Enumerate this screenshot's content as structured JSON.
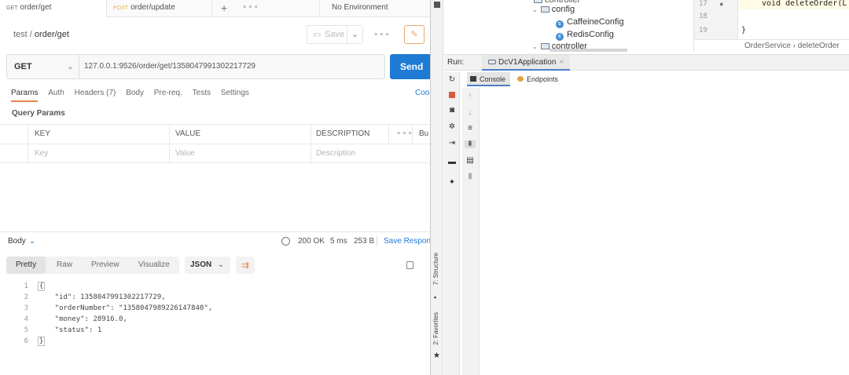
{
  "postman": {
    "tabs": [
      {
        "method": "GET",
        "name": "order/get",
        "active": true
      },
      {
        "method": "POST",
        "name": "order/update",
        "active": false
      }
    ],
    "new_tab_icon": "plus-icon",
    "environment": "No Environment",
    "breadcrumb": {
      "collection": "test",
      "sep": "/",
      "request": "order/get"
    },
    "save_label": "Save",
    "method": "GET",
    "url": "127.0.0.1:9526/order/get/1358047991302217729",
    "send_label": "Send",
    "request_tabs": [
      "Params",
      "Auth",
      "Headers (7)",
      "Body",
      "Pre-req.",
      "Tests",
      "Settings"
    ],
    "cookies_label": "Coo",
    "query_params_label": "Query Params",
    "params_table": {
      "headers": [
        "KEY",
        "VALUE",
        "DESCRIPTION",
        "Bu"
      ],
      "placeholders": [
        "Key",
        "Value",
        "Description"
      ]
    },
    "response": {
      "body_label": "Body",
      "status": "200 OK",
      "time": "5 ms",
      "size": "253 B",
      "save_label": "Save Respon",
      "view_tabs": [
        "Pretty",
        "Raw",
        "Preview",
        "Visualize"
      ],
      "format": "JSON",
      "lines": [
        {
          "n": "1",
          "text": "{"
        },
        {
          "n": "2",
          "text": "    \"id\": 1358047991302217729,"
        },
        {
          "n": "3",
          "text": "    \"orderNumber\": \"1358047989226147840\","
        },
        {
          "n": "4",
          "text": "    \"money\": 28916.0,"
        },
        {
          "n": "5",
          "text": "    \"status\": 1"
        },
        {
          "n": "6",
          "text": "}"
        }
      ]
    }
  },
  "ide": {
    "tree": {
      "partial_top": "controller",
      "items": [
        "config",
        "CaffeineConfig",
        "RedisConfig",
        "controller"
      ]
    },
    "editor": {
      "line_numbers": [
        "17",
        "18",
        "19"
      ],
      "line17": "void deleteOrder(L",
      "line19": "}",
      "breadcrumb": "OrderService  ›  deleteOrder"
    },
    "run": {
      "label": "Run:",
      "tab": "DcV1Application",
      "console_tab": "Console",
      "endpoints_tab": "Endpoints"
    },
    "side_tools": {
      "structure": "7: Structure",
      "favorites": "2: Favorites"
    }
  },
  "colors": {
    "send": "#1f7ad4",
    "accent_orange": "#e9834e",
    "post": "#f0b04a"
  }
}
